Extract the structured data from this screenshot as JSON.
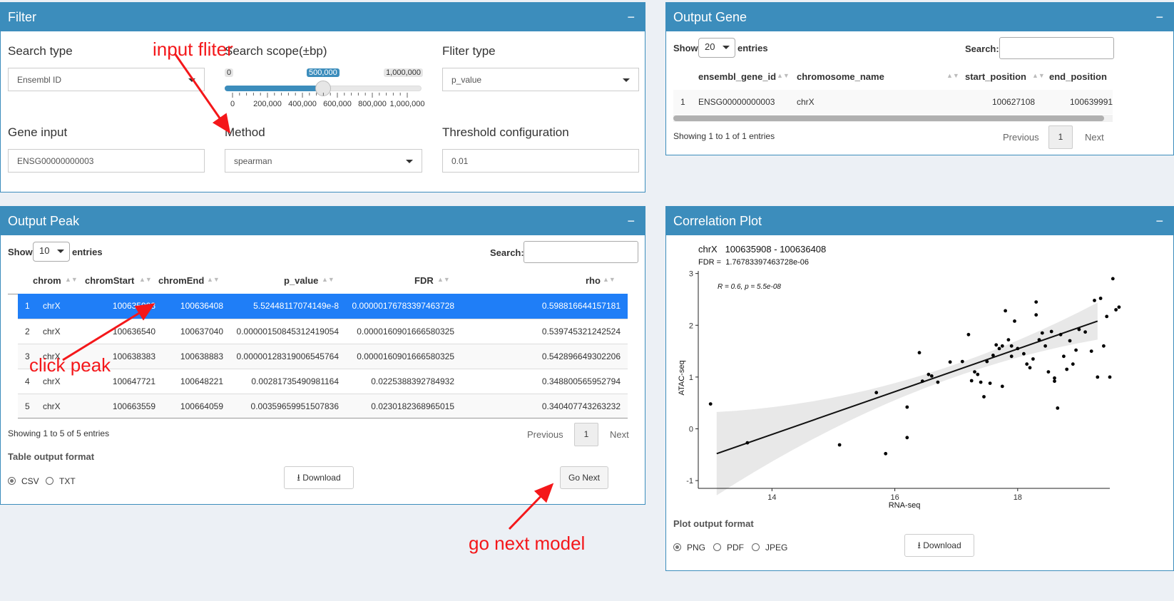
{
  "colors": {
    "header": "#3c8dbc",
    "selected_row": "#1f7ef7",
    "annotation": "#f4171a",
    "slider": "#3c8dbc"
  },
  "filter": {
    "title": "Filter",
    "collapse": "−",
    "search_type_label": "Search type",
    "search_type_value": "Ensembl ID",
    "scope_label": "Search scope(±bp)",
    "scope_min": "0",
    "scope_value": "500,000",
    "scope_max": "1,000,000",
    "scope_fraction": 0.5,
    "scope_ticks": [
      "0",
      "200,000",
      "400,000",
      "600,000",
      "800,000",
      "1,000,000"
    ],
    "filter_type_label": "Fliter type",
    "filter_type_value": "p_value",
    "gene_input_label": "Gene input",
    "gene_input_value": "ENSG00000000003",
    "method_label": "Method",
    "method_value": "spearman",
    "threshold_label": "Threshold configuration",
    "threshold_value": "0.01"
  },
  "output_peak": {
    "title": "Output Peak",
    "collapse": "−",
    "show": "Show",
    "entries_value": "10",
    "entries": "entries",
    "search": "Search:",
    "columns": [
      "chrom",
      "chromStart",
      "chromEnd",
      "p_value",
      "FDR",
      "rho"
    ],
    "rows": [
      [
        "1",
        "chrX",
        "100635908",
        "100636408",
        "5.52448117074149e-8",
        "0.0000017678339746372​8",
        "0.598816644157181"
      ],
      [
        "2",
        "chrX",
        "100636540",
        "100637040",
        "0.0000015084531241905​4",
        "0.0000160901666580325",
        "0.539745321242524"
      ],
      [
        "3",
        "chrX",
        "100638383",
        "100638883",
        "0.0000012831900654576​4",
        "0.0000160901666580325",
        "0.542896649302206"
      ],
      [
        "4",
        "chrX",
        "100647721",
        "100648221",
        "0.00281735490981164",
        "0.0225388392784932",
        "0.348800565952794"
      ],
      [
        "5",
        "chrX",
        "100663559",
        "100664059",
        "0.00359659951507836",
        "0.0230182368965015",
        "0.340407743263232"
      ]
    ],
    "info": "Showing 1 to 5 of 5 entries",
    "previous": "Previous",
    "page": "1",
    "next": "Next",
    "format_label": "Table output format",
    "format_options": [
      "CSV",
      "TXT"
    ],
    "download": "Download",
    "go_next": "Go Next"
  },
  "output_gene": {
    "title": "Output Gene",
    "collapse": "−",
    "show": "Show",
    "entries_value": "20",
    "entries": "entries",
    "search": "Search:",
    "columns": [
      "ensembl_gene_id",
      "chromosome_name",
      "start_position",
      "end_position"
    ],
    "row": [
      "1",
      "ENSG00000000003",
      "chrX",
      "100627108",
      "100639991"
    ],
    "info": "Showing 1 to 1 of 1 entries",
    "previous": "Previous",
    "page": "1",
    "next": "Next"
  },
  "correlation": {
    "title": "Correlation Plot",
    "collapse": "−",
    "plot_title": "chrX   100635908 - 100636408",
    "plot_subtitle": "FDR =  1.76783397463728e-06",
    "stat_text": "R = 0.6, p = 5.5e-08",
    "format_label": "Plot output format",
    "format_options": [
      "PNG",
      "PDF",
      "JPEG"
    ],
    "download": "Download",
    "chart_data": {
      "type": "scatter",
      "xlabel": "RNA-seq",
      "ylabel": "ATAC-seq",
      "xlim": [
        12.8,
        19.5
      ],
      "ylim": [
        -1.15,
        3.05
      ],
      "xticks": [
        14,
        16,
        18
      ],
      "yticks": [
        -1,
        0,
        1,
        2,
        3
      ],
      "regression": {
        "x": [
          13.1,
          19.3
        ],
        "y": [
          -0.48,
          2.08
        ]
      },
      "points": [
        [
          13.0,
          0.48
        ],
        [
          13.6,
          -0.27
        ],
        [
          15.1,
          -0.31
        ],
        [
          15.7,
          0.7
        ],
        [
          15.85,
          -0.48
        ],
        [
          16.2,
          0.42
        ],
        [
          16.2,
          -0.17
        ],
        [
          16.4,
          1.47
        ],
        [
          16.45,
          0.92
        ],
        [
          16.55,
          1.05
        ],
        [
          16.6,
          1.02
        ],
        [
          16.7,
          0.9
        ],
        [
          16.9,
          1.29
        ],
        [
          17.1,
          1.3
        ],
        [
          17.2,
          1.82
        ],
        [
          17.25,
          0.93
        ],
        [
          17.3,
          1.1
        ],
        [
          17.35,
          1.05
        ],
        [
          17.4,
          0.9
        ],
        [
          17.45,
          0.62
        ],
        [
          17.5,
          1.3
        ],
        [
          17.55,
          0.88
        ],
        [
          17.6,
          1.42
        ],
        [
          17.65,
          1.62
        ],
        [
          17.7,
          1.55
        ],
        [
          17.75,
          1.6
        ],
        [
          17.75,
          0.82
        ],
        [
          17.8,
          2.28
        ],
        [
          17.85,
          1.72
        ],
        [
          17.9,
          1.6
        ],
        [
          17.95,
          2.08
        ],
        [
          18.0,
          1.55
        ],
        [
          18.1,
          1.45
        ],
        [
          18.15,
          1.25
        ],
        [
          18.2,
          1.18
        ],
        [
          18.25,
          1.35
        ],
        [
          18.3,
          2.45
        ],
        [
          18.3,
          2.2
        ],
        [
          18.35,
          1.72
        ],
        [
          18.4,
          1.85
        ],
        [
          18.45,
          1.6
        ],
        [
          18.5,
          1.1
        ],
        [
          18.55,
          1.88
        ],
        [
          18.6,
          0.92
        ],
        [
          18.65,
          0.4
        ],
        [
          18.7,
          1.82
        ],
        [
          18.75,
          1.4
        ],
        [
          18.8,
          1.15
        ],
        [
          18.85,
          1.7
        ],
        [
          18.9,
          1.25
        ],
        [
          18.95,
          1.52
        ],
        [
          19.0,
          1.92
        ],
        [
          19.1,
          1.87
        ],
        [
          19.2,
          1.5
        ],
        [
          19.25,
          2.48
        ],
        [
          19.3,
          1.0
        ],
        [
          19.35,
          2.52
        ],
        [
          19.4,
          1.6
        ],
        [
          19.45,
          2.17
        ],
        [
          19.5,
          1.0
        ],
        [
          19.55,
          2.9
        ],
        [
          19.6,
          2.3
        ],
        [
          19.65,
          2.35
        ],
        [
          18.6,
          0.98
        ],
        [
          17.9,
          1.4
        ]
      ]
    }
  },
  "annotations": {
    "input_filter": "input fliter",
    "click_peak": "click peak",
    "go_next_model": "go next model"
  }
}
